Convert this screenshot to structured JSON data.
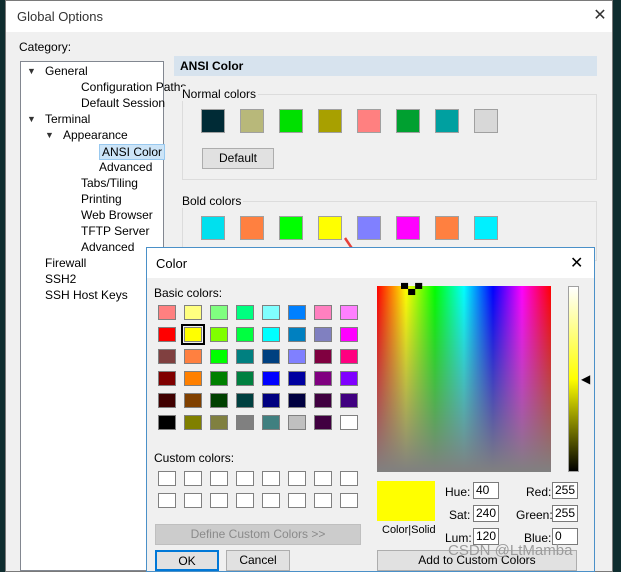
{
  "window": {
    "title": "Global Options",
    "category_label": "Category:"
  },
  "tree": [
    {
      "label": "General",
      "level": 0,
      "expanded": true
    },
    {
      "label": "Configuration Paths",
      "level": 2
    },
    {
      "label": "Default Session",
      "level": 2
    },
    {
      "label": "Terminal",
      "level": 0,
      "expanded": true
    },
    {
      "label": "Appearance",
      "level": 1,
      "expanded": true
    },
    {
      "label": "ANSI Color",
      "level": 3,
      "selected": true
    },
    {
      "label": "Advanced",
      "level": 3
    },
    {
      "label": "Tabs/Tiling",
      "level": 2
    },
    {
      "label": "Printing",
      "level": 2
    },
    {
      "label": "Web Browser",
      "level": 2
    },
    {
      "label": "TFTP Server",
      "level": 2
    },
    {
      "label": "Advanced",
      "level": 2
    },
    {
      "label": "Firewall",
      "level": 0
    },
    {
      "label": "SSH2",
      "level": 0
    },
    {
      "label": "SSH Host Keys",
      "level": 0
    }
  ],
  "panel": {
    "title": "ANSI Color",
    "normal_label": "Normal colors",
    "bold_label": "Bold colors",
    "default_button": "Default",
    "normal_colors": [
      "#002b36",
      "#b8b87a",
      "#00e000",
      "#a8a000",
      "#ff8080",
      "#00a030",
      "#00a0a0",
      "#d8d8d8"
    ],
    "bold_colors": [
      "#00e0ee",
      "#ff8040",
      "#00ff00",
      "#ffff00",
      "#8080ff",
      "#ff00ff",
      "#ff8040",
      "#00f0ff"
    ]
  },
  "color_dialog": {
    "title": "Color",
    "basic_label": "Basic colors:",
    "custom_label": "Custom colors:",
    "define_button": "Define Custom Colors >>",
    "ok_button": "OK",
    "cancel_button": "Cancel",
    "add_button": "Add to Custom Colors",
    "preview_label": "Color|Solid",
    "basic_colors": [
      [
        "#ff8080",
        "#ffff80",
        "#80ff80",
        "#00ff80",
        "#80ffff",
        "#0080ff",
        "#ff80c0",
        "#ff80ff"
      ],
      [
        "#ff0000",
        "#ffff00",
        "#80ff00",
        "#00ff40",
        "#00ffff",
        "#0080c0",
        "#8080c0",
        "#ff00ff"
      ],
      [
        "#804040",
        "#ff8040",
        "#00ff00",
        "#008080",
        "#004080",
        "#8080ff",
        "#800040",
        "#ff0080"
      ],
      [
        "#800000",
        "#ff8000",
        "#008000",
        "#008040",
        "#0000ff",
        "#0000a0",
        "#800080",
        "#8000ff"
      ],
      [
        "#400000",
        "#804000",
        "#004000",
        "#004040",
        "#000080",
        "#000040",
        "#400040",
        "#400080"
      ],
      [
        "#000000",
        "#808000",
        "#808040",
        "#808080",
        "#408080",
        "#c0c0c0",
        "#400040",
        "#ffffff"
      ]
    ],
    "selected_basic": [
      1,
      1
    ],
    "fields": {
      "hue_label": "Hue:",
      "hue": "40",
      "sat_label": "Sat:",
      "sat": "240",
      "lum_label": "Lum:",
      "lum": "120",
      "red_label": "Red:",
      "red": "255",
      "green_label": "Green:",
      "green": "255",
      "blue_label": "Blue:",
      "blue": "0"
    },
    "current_color": "#ffff00"
  },
  "watermark": "CSDN @LtMamba"
}
